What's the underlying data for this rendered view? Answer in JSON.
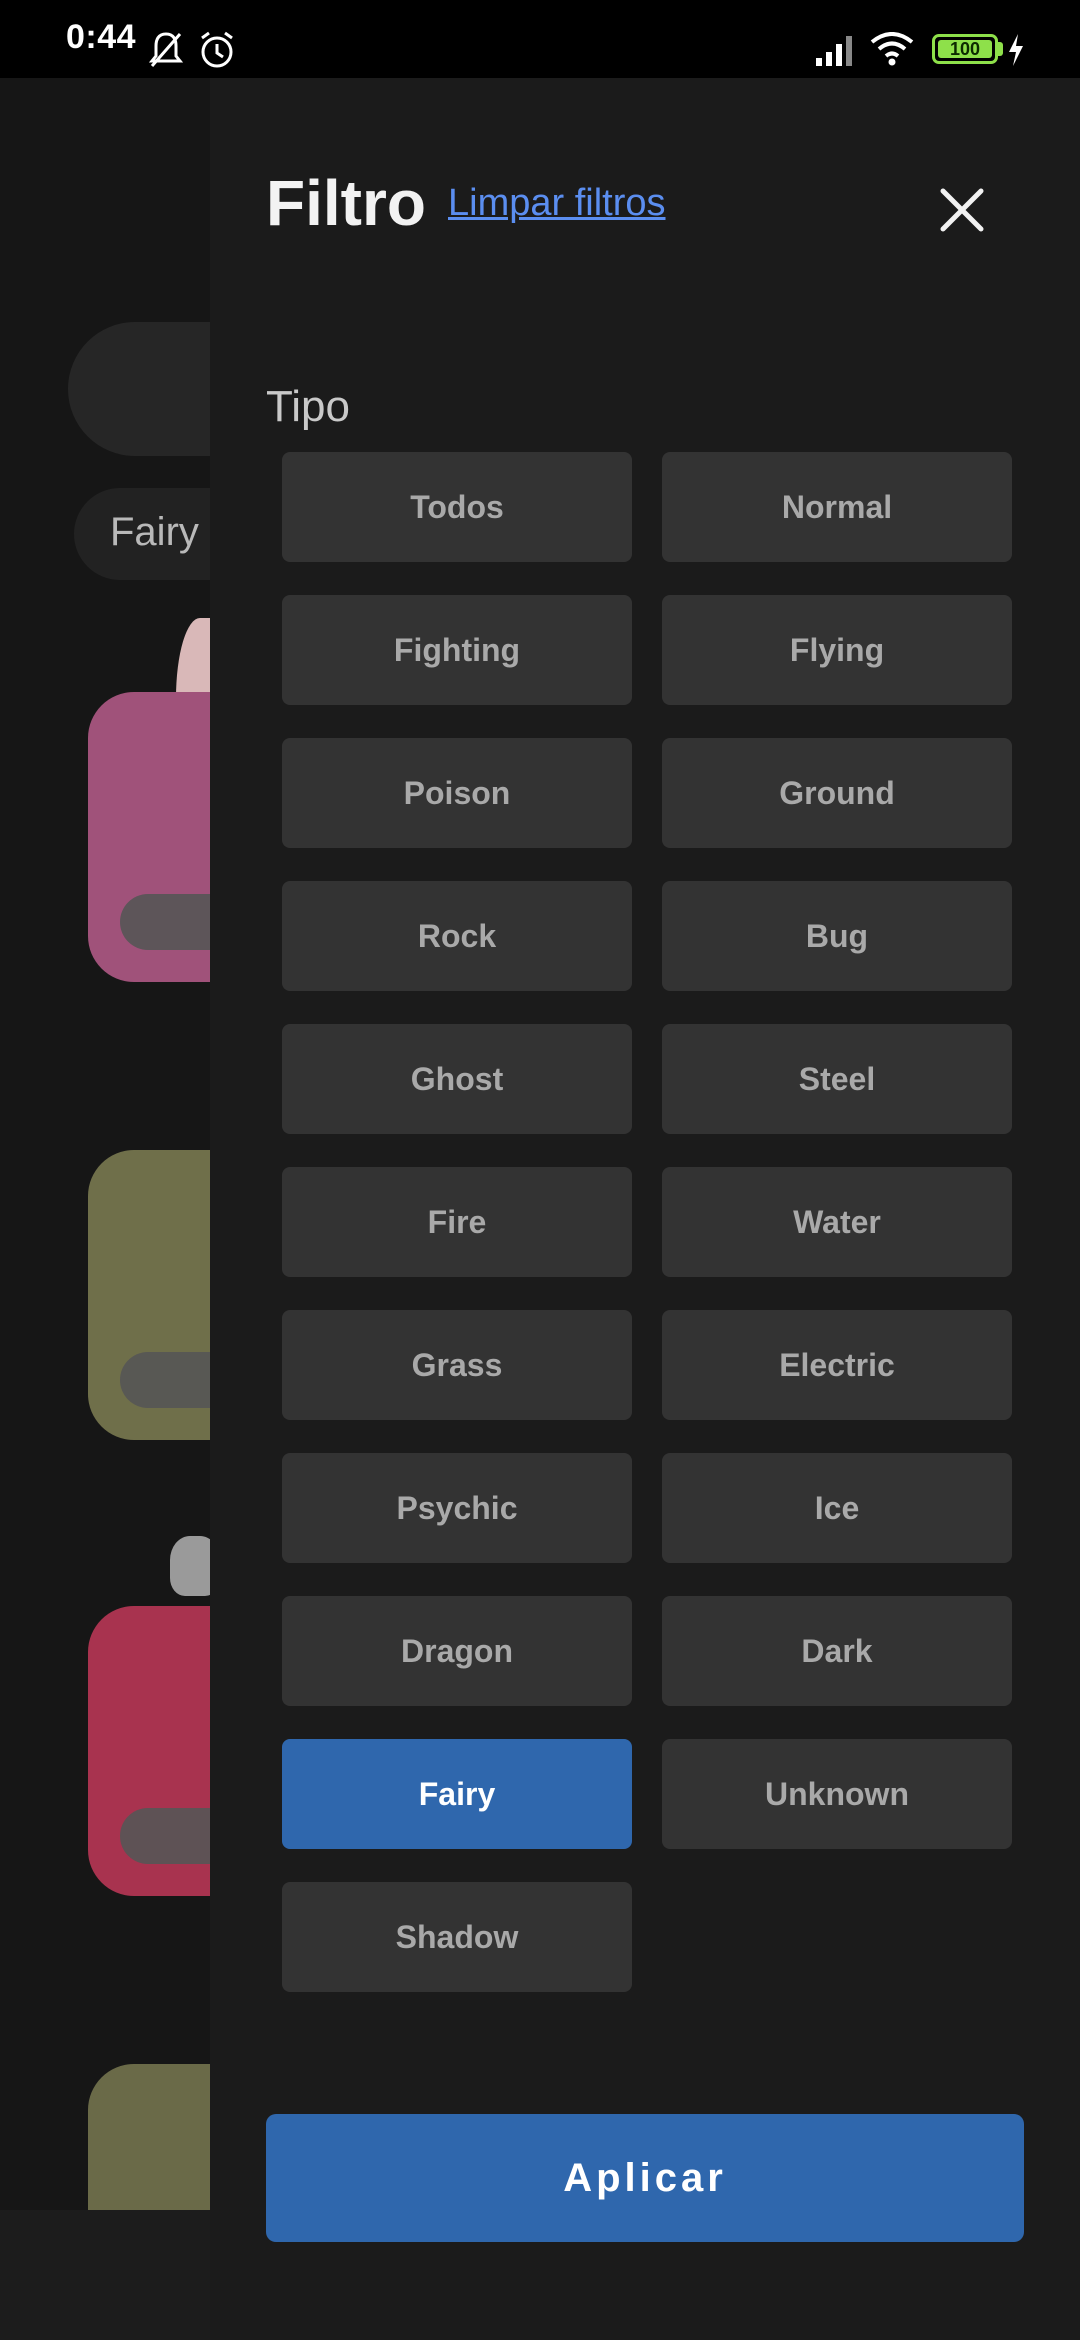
{
  "status_bar": {
    "time": "0:44",
    "battery": "100",
    "icons": [
      "notifications-off-icon",
      "alarm-icon",
      "signal-icon",
      "wifi-icon",
      "battery-icon",
      "charging-icon"
    ]
  },
  "background": {
    "filter_chip": "Fairy"
  },
  "drawer": {
    "title": "Filtro",
    "clear_label": "Limpar filtros",
    "section_label": "Tipo",
    "types": [
      "Todos",
      "Normal",
      "Fighting",
      "Flying",
      "Poison",
      "Ground",
      "Rock",
      "Bug",
      "Ghost",
      "Steel",
      "Fire",
      "Water",
      "Grass",
      "Electric",
      "Psychic",
      "Ice",
      "Dragon",
      "Dark",
      "Fairy",
      "Unknown",
      "Shadow"
    ],
    "selected_type": "Fairy",
    "apply_label": "Aplicar"
  },
  "colors": {
    "accent": "#2f67ad",
    "link": "#5b8ef0",
    "drawer_bg": "#1b1b1b",
    "button_bg": "#333333",
    "card_pink": "#a0527a",
    "card_olive": "#6f6f4a",
    "card_red": "#a8334f"
  }
}
